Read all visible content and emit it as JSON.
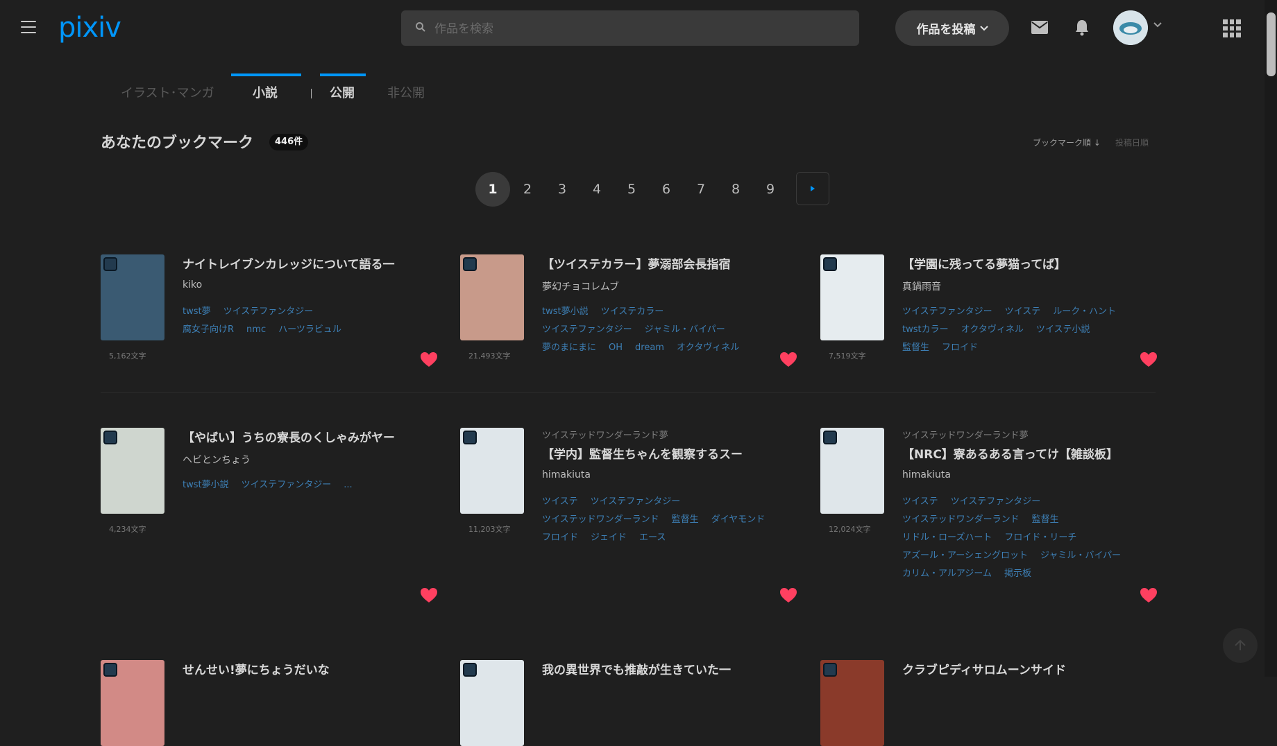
{
  "header": {
    "logo": "pixiv",
    "search_placeholder": "作品を検索",
    "post_button": "作品を投稿"
  },
  "tabs": {
    "illust_manga": "イラスト･マンガ",
    "novel": "小説",
    "public": "公開",
    "private": "非公開"
  },
  "bookmarks": {
    "title": "あなたのブックマーク",
    "count": "446件",
    "sort_bookmark": "ブックマーク順 ↓",
    "sort_posted": "投稿日順"
  },
  "pagination": {
    "pages": [
      "1",
      "2",
      "3",
      "4",
      "5",
      "6",
      "7",
      "8",
      "9"
    ],
    "current": "1"
  },
  "colors": {
    "accent": "#0096fa",
    "background": "#1f1f1f",
    "heart": "#ff4060",
    "tag": "#3d7fb5"
  },
  "cards": [
    {
      "series": "",
      "title": "ナイトレイブンカレッジについて語る一",
      "author": "kiko",
      "tags": [
        "twst夢",
        "ツイステファンタジー",
        "腐女子向けR",
        "nmc",
        "ハーツラビュル"
      ],
      "count": "5,162文字",
      "thumb": "#3a5a72"
    },
    {
      "series": "",
      "title": "【ツイステカラー】夢溺部会長指宿",
      "author": "夢幻チョコレムブ",
      "tags": [
        "twst夢小説",
        "ツイステカラー",
        "ツイステファンタジー",
        "ジャミル・バイパー",
        "夢のまにまに",
        "OH",
        "dream",
        "オクタヴィネル"
      ],
      "count": "21,493文字",
      "thumb": "#c89a8a"
    },
    {
      "series": "",
      "title": "【学園に残ってる夢猫ってば】",
      "author": "真鍋雨音",
      "tags": [
        "ツイステファンタジー",
        "ツイステ",
        "ルーク・ハント",
        "twstカラー",
        "オクタヴィネル",
        "ツイステ小説",
        "監督生",
        "フロイド"
      ],
      "count": "7,519文字",
      "thumb": "#e6ecef"
    },
    {
      "series": "",
      "title": "【やばい】うちの寮長のくしゃみがヤー",
      "author": "ヘビとンちょう",
      "tags": [
        "twst夢小説",
        "ツイステファンタジー",
        "..."
      ],
      "count": "4,234文字",
      "thumb": "#cfd6cf"
    },
    {
      "series": "ツイステッドワンダーランド夢",
      "title": "【学内】監督生ちゃんを観察するスー",
      "author": "himakiuta",
      "tags": [
        "ツイステ",
        "ツイステファンタジー",
        "ツイステッドワンダーランド",
        "監督生",
        "ダイヤモンド",
        "フロイド",
        "ジェイド",
        "エース"
      ],
      "count": "11,203文字",
      "thumb": "#dfe6ea"
    },
    {
      "series": "ツイステッドワンダーランド夢",
      "title": "【NRC】寮あるある言ってけ【雑談板】",
      "author": "himakiuta",
      "tags": [
        "ツイステ",
        "ツイステファンタジー",
        "ツイステッドワンダーランド",
        "監督生",
        "リドル・ローズハート",
        "フロイド・リーチ",
        "アズール・アーシェングロット",
        "ジャミル・バイパー",
        "カリム・アルアジーム",
        "掲示板"
      ],
      "count": "12,024文字",
      "thumb": "#dfe6ea"
    },
    {
      "series": "",
      "title": "せんせい!夢にちょうだいな",
      "author": "",
      "tags": [],
      "count": "",
      "thumb": "#d28a86"
    },
    {
      "series": "",
      "title": "我の異世界でも推敲が生きていた一",
      "author": "",
      "tags": [],
      "count": "",
      "thumb": "#dfe6ea"
    },
    {
      "series": "",
      "title": "クラブピディサロムーンサイド",
      "author": "",
      "tags": [],
      "count": "",
      "thumb": "#8a3a2a"
    }
  ]
}
